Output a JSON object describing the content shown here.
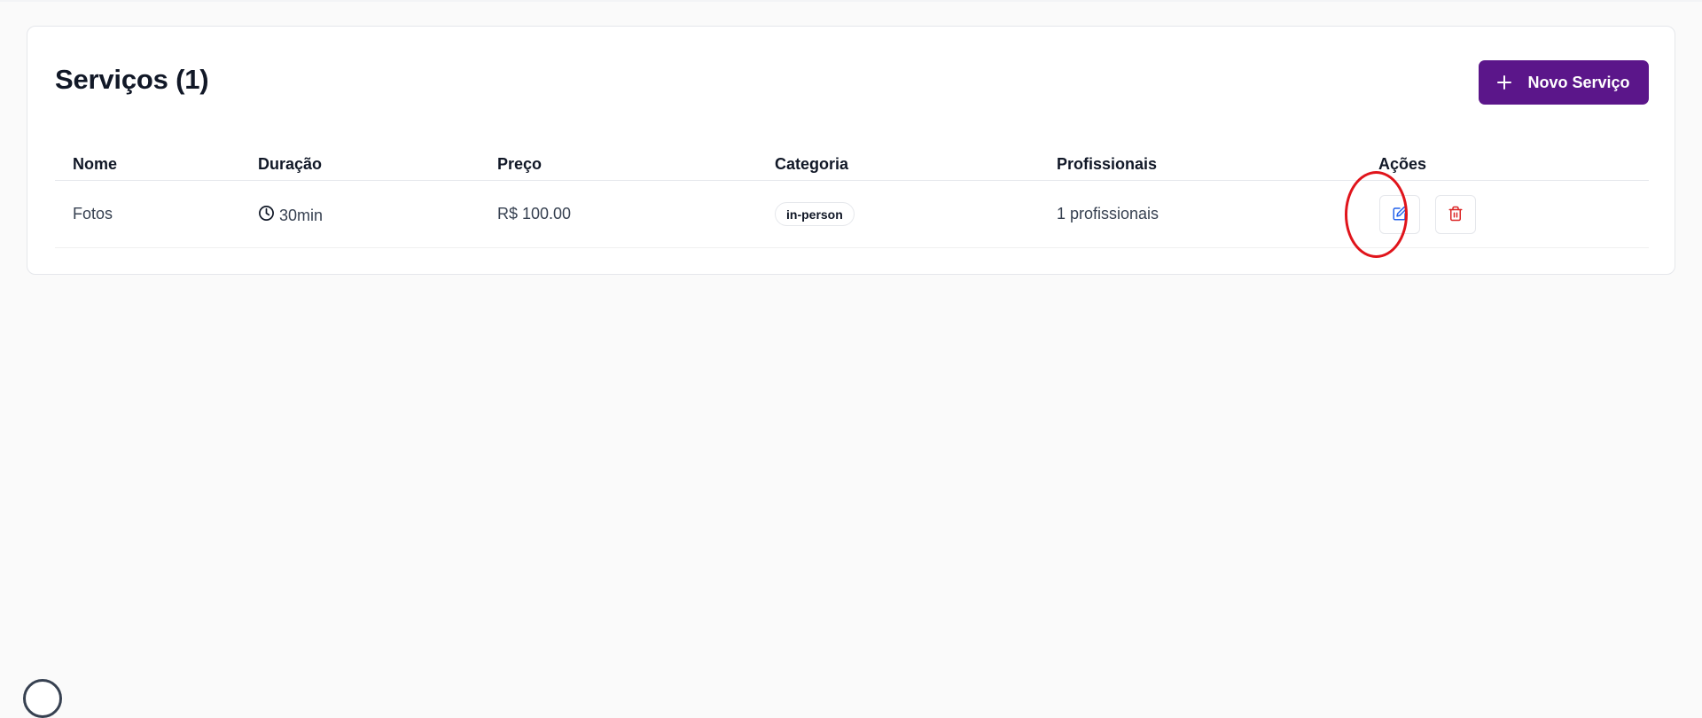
{
  "header": {
    "title": "Serviços (1)",
    "new_button_label": "Novo Serviço"
  },
  "table": {
    "columns": [
      "Nome",
      "Duração",
      "Preço",
      "Categoria",
      "Profissionais",
      "Ações"
    ],
    "rows": [
      {
        "name": "Fotos",
        "duration": "30min",
        "price": "R$ 100.00",
        "category": "in-person",
        "professionals": "1 profissionais"
      }
    ]
  },
  "icons": {
    "add": "plus-icon",
    "duration": "clock-icon",
    "edit": "edit-icon",
    "delete": "trash-icon"
  },
  "colors": {
    "primary": "#5b168a",
    "edit_icon": "#2563eb",
    "delete_icon": "#dc2626",
    "highlight_annotation": "#e0141b"
  }
}
